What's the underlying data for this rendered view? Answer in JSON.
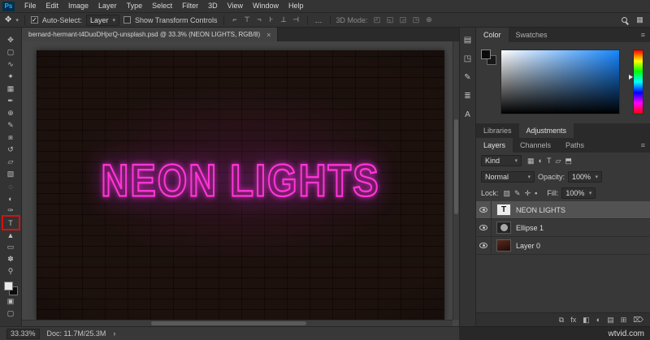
{
  "app": {
    "logo": "Ps"
  },
  "menu": {
    "items": [
      "File",
      "Edit",
      "Image",
      "Layer",
      "Type",
      "Select",
      "Filter",
      "3D",
      "View",
      "Window",
      "Help"
    ]
  },
  "options": {
    "move_tool_glyph": "✥",
    "auto_select_check": "✓",
    "auto_select_label": "Auto-Select:",
    "auto_select_value": "Layer",
    "show_transform_check": "",
    "show_transform_label": "Show Transform Controls",
    "more_glyph": "…",
    "mode_3d_label": "3D Mode:",
    "align_icons": [
      {
        "name": "align-left-edges-icon",
        "glyph": "⌐"
      },
      {
        "name": "align-horizontal-centers-icon",
        "glyph": "⊤"
      },
      {
        "name": "align-right-edges-icon",
        "glyph": "¬"
      },
      {
        "name": "align-top-edges-icon",
        "glyph": "⊦"
      },
      {
        "name": "align-vertical-centers-icon",
        "glyph": "⊥"
      },
      {
        "name": "align-bottom-edges-icon",
        "glyph": "⊣"
      }
    ],
    "mode3d_icons": [
      {
        "name": "3d-rotate-icon",
        "glyph": "◰"
      },
      {
        "name": "3d-roll-icon",
        "glyph": "◱"
      },
      {
        "name": "3d-drag-icon",
        "glyph": "◲"
      },
      {
        "name": "3d-slide-icon",
        "glyph": "◳"
      },
      {
        "name": "3d-scale-icon",
        "glyph": "⊕"
      }
    ],
    "workspace_glyph": "▦"
  },
  "toolbar": {
    "tools": [
      {
        "name": "move",
        "glyph": "✥"
      },
      {
        "name": "rectangular-marquee",
        "glyph": "▢"
      },
      {
        "name": "lasso",
        "glyph": "∿"
      },
      {
        "name": "quick-selection",
        "glyph": "✦"
      },
      {
        "name": "crop",
        "glyph": "▦"
      },
      {
        "name": "eyedropper",
        "glyph": "✒"
      },
      {
        "name": "spot-healing-brush",
        "glyph": "⊕"
      },
      {
        "name": "brush",
        "glyph": "✎"
      },
      {
        "name": "clone-stamp",
        "glyph": "⧆"
      },
      {
        "name": "history-brush",
        "glyph": "↺"
      },
      {
        "name": "eraser",
        "glyph": "▱"
      },
      {
        "name": "gradient",
        "glyph": "▧"
      },
      {
        "name": "blur",
        "glyph": "◌"
      },
      {
        "name": "dodge",
        "glyph": "◐"
      },
      {
        "name": "pen",
        "glyph": "✑"
      },
      {
        "name": "horizontal-type",
        "glyph": "T",
        "highlight": true
      },
      {
        "name": "path-selection",
        "glyph": "▲"
      },
      {
        "name": "rectangle",
        "glyph": "▭"
      },
      {
        "name": "hand",
        "glyph": "✽"
      },
      {
        "name": "zoom",
        "glyph": "⚲"
      }
    ],
    "extra_tools": [
      {
        "name": "quick-mask-mode",
        "glyph": "▣"
      },
      {
        "name": "screen-mode",
        "glyph": "▢"
      }
    ]
  },
  "document": {
    "tab_title": "bernard-hermant-t4DuoDHjxrQ-unsplash.psd @ 33.3% (NEON LIGHTS, RGB/8)",
    "close_glyph": "×",
    "neon_text": "NEON LIGHTS"
  },
  "dock": {
    "icons": [
      {
        "name": "history-panel-icon",
        "glyph": "▤"
      },
      {
        "name": "properties-panel-icon",
        "glyph": "◳"
      },
      {
        "name": "brush-settings-panel-icon",
        "glyph": "✎"
      },
      {
        "name": "paragraph-panel-icon",
        "glyph": "≣"
      },
      {
        "name": "character-panel-icon",
        "glyph": "A"
      }
    ]
  },
  "color_panel": {
    "tabs": [
      {
        "label": "Color",
        "active": true
      },
      {
        "label": "Swatches",
        "active": false
      }
    ],
    "menu_glyph": "≡"
  },
  "libraries_panel": {
    "tabs": [
      {
        "label": "Libraries",
        "active": false
      },
      {
        "label": "Adjustments",
        "active": true
      }
    ]
  },
  "layers_panel": {
    "tabs": [
      {
        "label": "Layers",
        "active": true
      },
      {
        "label": "Channels",
        "active": false
      },
      {
        "label": "Paths",
        "active": false
      }
    ],
    "menu_glyph": "≡",
    "kind_label": "Kind",
    "filter_icons": [
      {
        "name": "filter-pixel-layers-icon",
        "glyph": "▦"
      },
      {
        "name": "filter-adjustment-layers-icon",
        "glyph": "◐"
      },
      {
        "name": "filter-type-layers-icon",
        "glyph": "T"
      },
      {
        "name": "filter-shape-layers-icon",
        "glyph": "▱"
      },
      {
        "name": "filter-smart-objects-icon",
        "glyph": "⬒"
      }
    ],
    "blend_mode": "Normal",
    "opacity_label": "Opacity:",
    "opacity_value": "100%",
    "lock_label": "Lock:",
    "lock_icons": [
      {
        "name": "lock-transparency-icon",
        "glyph": "▨"
      },
      {
        "name": "lock-image-icon",
        "glyph": "✎"
      },
      {
        "name": "lock-position-icon",
        "glyph": "✛"
      },
      {
        "name": "lock-all-icon",
        "glyph": "▪"
      }
    ],
    "fill_label": "Fill:",
    "fill_value": "100%",
    "layers": [
      {
        "name": "NEON LIGHTS",
        "type": "text",
        "selected": true
      },
      {
        "name": "Ellipse 1",
        "type": "shape",
        "selected": false
      },
      {
        "name": "Layer 0",
        "type": "image",
        "selected": false
      }
    ],
    "bottom_icons": [
      {
        "name": "link-layers-icon",
        "glyph": "⧉"
      },
      {
        "name": "layer-effects-icon",
        "glyph": "fx"
      },
      {
        "name": "layer-mask-icon",
        "glyph": "◧"
      },
      {
        "name": "adjustment-layer-icon",
        "glyph": "◐"
      },
      {
        "name": "new-group-icon",
        "glyph": "▤"
      },
      {
        "name": "new-layer-icon",
        "glyph": "⊞"
      },
      {
        "name": "delete-layer-icon",
        "glyph": "⌦"
      }
    ]
  },
  "status": {
    "zoom": "33.33%",
    "doc_info": "Doc: 11.7M/25.3M",
    "chevron": "›"
  },
  "watermark": "wtvid.com",
  "colors": {
    "neon_accent": "#ff35d8",
    "highlight_red": "#d41111",
    "picker_blue": "#1586ff"
  }
}
